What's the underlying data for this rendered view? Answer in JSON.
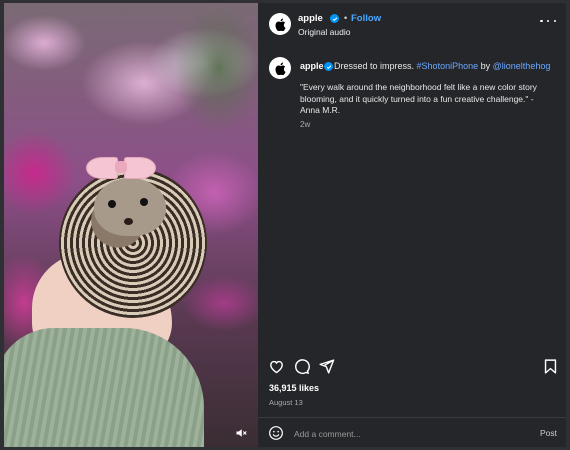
{
  "post": {
    "username": "apple",
    "follow_label": "Follow",
    "separator": "•",
    "audio_label": "Original audio",
    "caption": {
      "username": "apple",
      "text": "Dressed to impress.",
      "hashtag": "#ShotoniPhone",
      "by": "by",
      "mention": "@lionelthehog",
      "quote": "\"Every walk around the neighborhood felt like a new color story blooming, and it quickly turned into a fun creative challenge.\" - Anna M.R.",
      "time_ago": "2w"
    },
    "likes": "36,915 likes",
    "date": "August 13"
  },
  "comment": {
    "placeholder": "Add a comment...",
    "post_label": "Post"
  },
  "icons": {
    "more": "more-options-icon",
    "like": "heart-icon",
    "comment": "comment-icon",
    "share": "share-icon",
    "save": "bookmark-icon",
    "emoji": "emoji-icon",
    "mute": "speaker-muted-icon"
  },
  "colors": {
    "panel_bg": "#25262a",
    "link_blue": "#6aa8ff",
    "verified_blue": "#0095f6"
  }
}
